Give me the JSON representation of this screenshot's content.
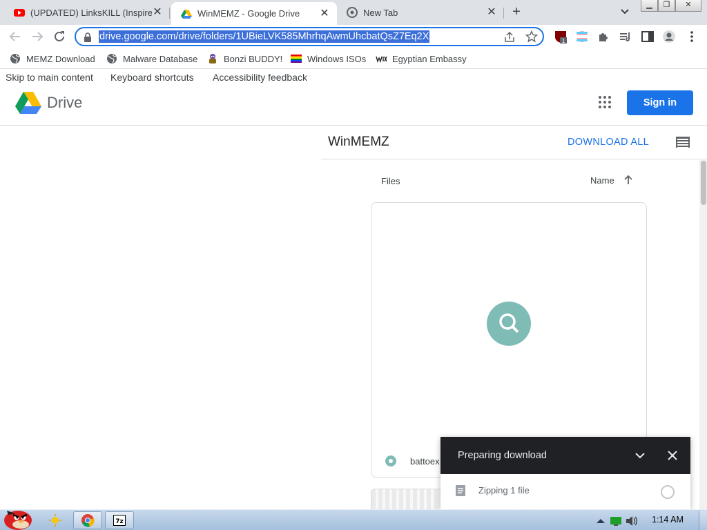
{
  "tabs": [
    {
      "title": "(UPDATED) LinksKILL (Inspired",
      "favicon": "youtube-icon",
      "close": "✕"
    },
    {
      "title": "WinMEMZ - Google Drive",
      "favicon": "google-drive-icon",
      "close": "✕"
    },
    {
      "title": "New Tab",
      "favicon": "chrome-icon",
      "close": "✕"
    }
  ],
  "new_tab_symbol": "+",
  "window_buttons": {
    "minimize": "▁",
    "maximize": "❐",
    "close": "✕"
  },
  "omnibox": {
    "url": "drive.google.com/drive/folders/1UBieLVK585MhrhqAwmUhcbatQsZ7Eq2X"
  },
  "toolbar_extensions": {
    "ublock_badge": "1"
  },
  "bookmarks": [
    {
      "label": "MEMZ Download",
      "icon": "globe-icon"
    },
    {
      "label": "Malware Database",
      "icon": "globe-icon"
    },
    {
      "label": "Bonzi BUDDY!",
      "icon": "bonzi-icon"
    },
    {
      "label": "Windows ISOs",
      "icon": "rainbow-flag-icon"
    },
    {
      "label": "Egyptian Embassy",
      "icon": "wix-icon"
    }
  ],
  "skip_links": [
    "Skip to main content",
    "Keyboard shortcuts",
    "Accessibility feedback"
  ],
  "drive": {
    "logo_text": "Drive",
    "sign_in": "Sign in",
    "folder_title": "WinMEMZ",
    "download_all": "DOWNLOAD ALL",
    "files_label": "Files",
    "sort_label": "Name",
    "file_name": "battoex"
  },
  "download_panel": {
    "title": "Preparing download",
    "item": "Zipping 1 file"
  },
  "taskbar": {
    "clock": "1:14 AM"
  },
  "colors": {
    "accent": "#1a73e8",
    "spinner": "#7fbcb5",
    "panel_header": "#202124"
  }
}
